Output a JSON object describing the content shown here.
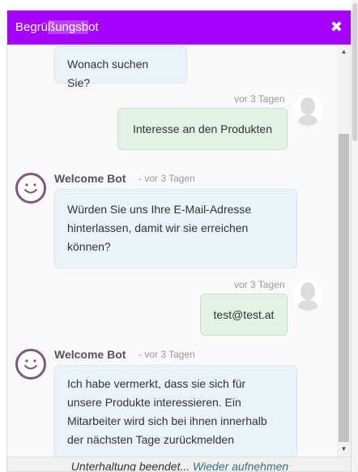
{
  "header": {
    "title_part1": "Begrü",
    "title_selected": "ßungsb",
    "title_part2": "ot",
    "close_icon": "close-icon"
  },
  "messages": [
    {
      "sender": "bot",
      "text": "Wonach suchen Sie?"
    },
    {
      "sender": "user",
      "time": "vor 3 Tagen",
      "text": "Interesse an den Produkten"
    },
    {
      "sender": "bot",
      "name": "Welcome Bot",
      "time": "- vor 3 Tagen",
      "lines": [
        "Würden Sie uns Ihre E-Mail-Adresse",
        "hinterlassen, damit wir sie erreichen",
        "können?"
      ]
    },
    {
      "sender": "user",
      "time": "vor 3 Tagen",
      "text": "test@test.at"
    },
    {
      "sender": "bot",
      "name": "Welcome Bot",
      "time": "- vor 3 Tagen",
      "lines": [
        "Ich habe vermerkt, dass sie sich für",
        "unsere Produkte interessieren. Ein",
        "Mitarbeiter wird sich bei ihnen innerhalb",
        "der nächsten Tage zurückmelden"
      ]
    }
  ],
  "footer": {
    "ended_text": "Unterhaltung beendet...",
    "restart_link": "Wieder aufnehmen"
  },
  "colors": {
    "header": "#a600ff",
    "bot_bubble": "#eaf3f8",
    "user_bubble": "#e2f2e4",
    "bot_avatar_ring": "#7f5582"
  }
}
